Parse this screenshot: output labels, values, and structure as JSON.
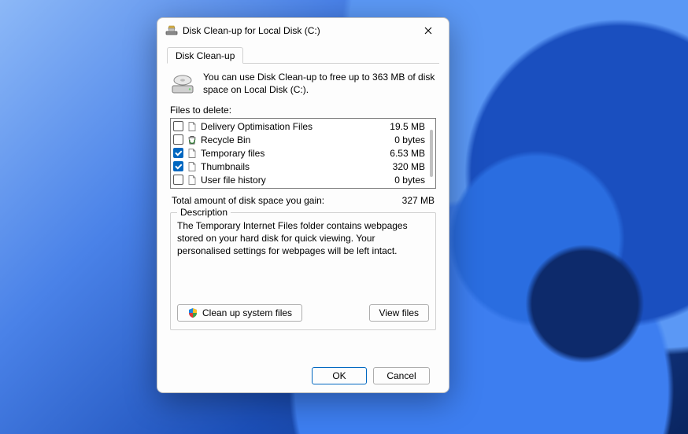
{
  "window": {
    "title": "Disk Clean-up for Local Disk  (C:)"
  },
  "tab": {
    "label": "Disk Clean-up"
  },
  "intro": "You can use Disk Clean-up to free up to 363 MB of disk space on Local Disk  (C:).",
  "files_label": "Files to delete:",
  "files": [
    {
      "checked": false,
      "icon": "page",
      "name": "Delivery Optimisation Files",
      "size": "19.5 MB"
    },
    {
      "checked": false,
      "icon": "recycle",
      "name": "Recycle Bin",
      "size": "0 bytes"
    },
    {
      "checked": true,
      "icon": "page",
      "name": "Temporary files",
      "size": "6.53 MB"
    },
    {
      "checked": true,
      "icon": "page",
      "name": "Thumbnails",
      "size": "320 MB"
    },
    {
      "checked": false,
      "icon": "page",
      "name": "User file history",
      "size": "0 bytes"
    }
  ],
  "total": {
    "label": "Total amount of disk space you gain:",
    "value": "327 MB"
  },
  "description": {
    "legend": "Description",
    "text": "The Temporary Internet Files folder contains webpages stored on your hard disk for quick viewing. Your personalised settings for webpages will be left intact."
  },
  "buttons": {
    "cleanup_system": "Clean up system files",
    "view_files": "View files",
    "ok": "OK",
    "cancel": "Cancel"
  }
}
